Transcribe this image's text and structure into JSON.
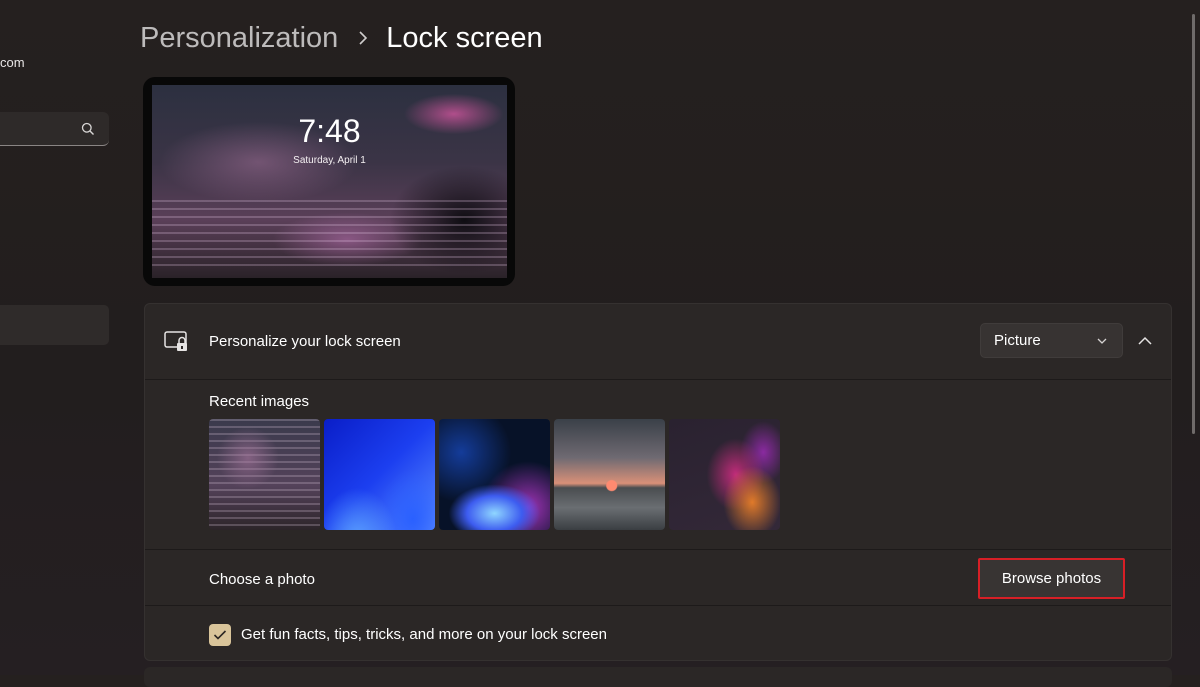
{
  "left_nav": {
    "account_text": "com",
    "search": {
      "value": "",
      "icon": "search-icon"
    }
  },
  "header": {
    "breadcrumb_parent": "Personalization",
    "breadcrumb_current": "Lock screen"
  },
  "preview": {
    "time": "7:48",
    "date": "Saturday, April 1"
  },
  "lock_screen_card": {
    "icon": "lock-screen-icon",
    "title": "Personalize your lock screen",
    "dropdown_value": "Picture",
    "recent_images_label": "Recent images",
    "recent_images": [
      "umbrella-rain-city",
      "blue-bloom",
      "blue-glow",
      "sunset-lake",
      "abstract-ribbon"
    ],
    "choose_photo_label": "Choose a photo",
    "browse_button": "Browse photos",
    "fun_facts_label": "Get fun facts, tips, tricks, and more on your lock screen",
    "fun_facts_checked": true
  },
  "colors": {
    "accent_checkbox": "#d9c49a",
    "highlight_border": "#d71f26",
    "card_background": "#2b2726"
  }
}
